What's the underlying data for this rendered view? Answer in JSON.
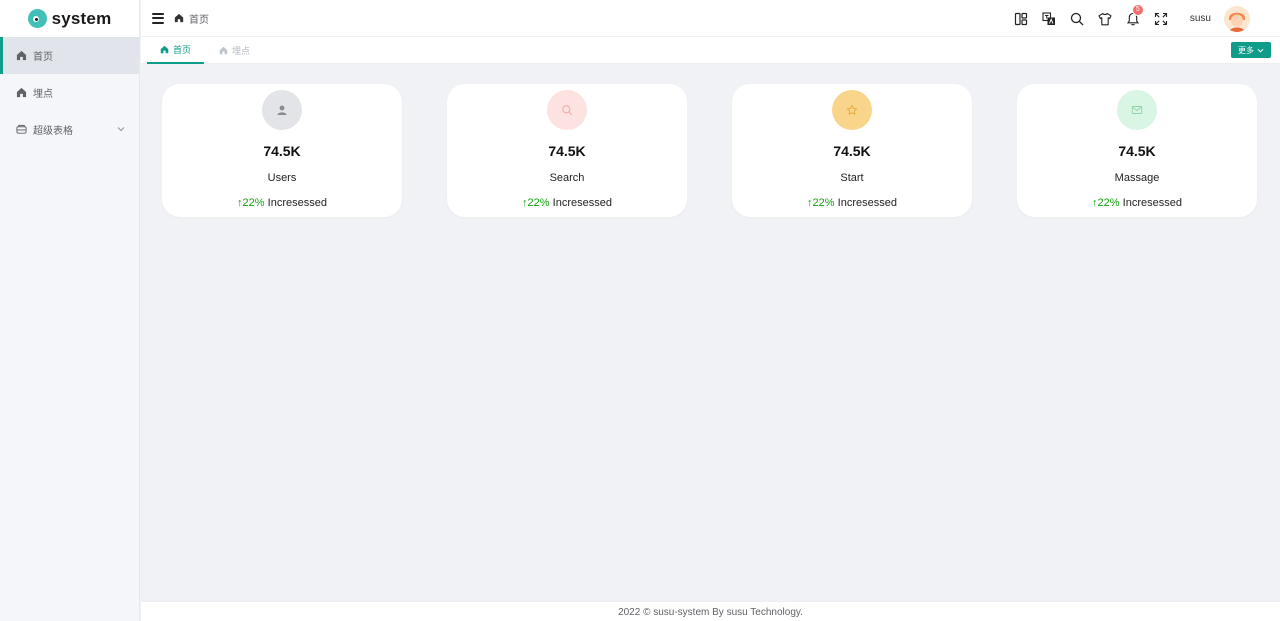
{
  "app": {
    "name": "system"
  },
  "sidebar": {
    "items": [
      {
        "label": "首页",
        "icon": "home-icon"
      },
      {
        "label": "埋点",
        "icon": "home-icon"
      },
      {
        "label": "超级表格",
        "icon": "table-icon"
      }
    ]
  },
  "header": {
    "breadcrumb": "首页",
    "notification_count": "5",
    "username": "susu"
  },
  "tabs": {
    "items": [
      {
        "label": "首页"
      },
      {
        "label": "埋点"
      }
    ],
    "more_label": "更多"
  },
  "cards": [
    {
      "value": "74.5K",
      "label": "Users",
      "trend": "22%",
      "trend_text": "Incresessed",
      "icon": "user-icon",
      "color": "#e2e4e8"
    },
    {
      "value": "74.5K",
      "label": "Search",
      "trend": "22%",
      "trend_text": "Incresessed",
      "icon": "search-icon",
      "color": "#fde2e2"
    },
    {
      "value": "74.5K",
      "label": "Start",
      "trend": "22%",
      "trend_text": "Incresessed",
      "icon": "star-icon",
      "color": "#f8d58a"
    },
    {
      "value": "74.5K",
      "label": "Massage",
      "trend": "22%",
      "trend_text": "Incresessed",
      "icon": "mail-icon",
      "color": "#d9f5e4"
    }
  ],
  "footer": {
    "text": "2022 © susu-system By susu Technology."
  },
  "colors": {
    "accent": "#0f9d8a",
    "trend_up": "#13a10e",
    "badge": "#f56c6c"
  }
}
